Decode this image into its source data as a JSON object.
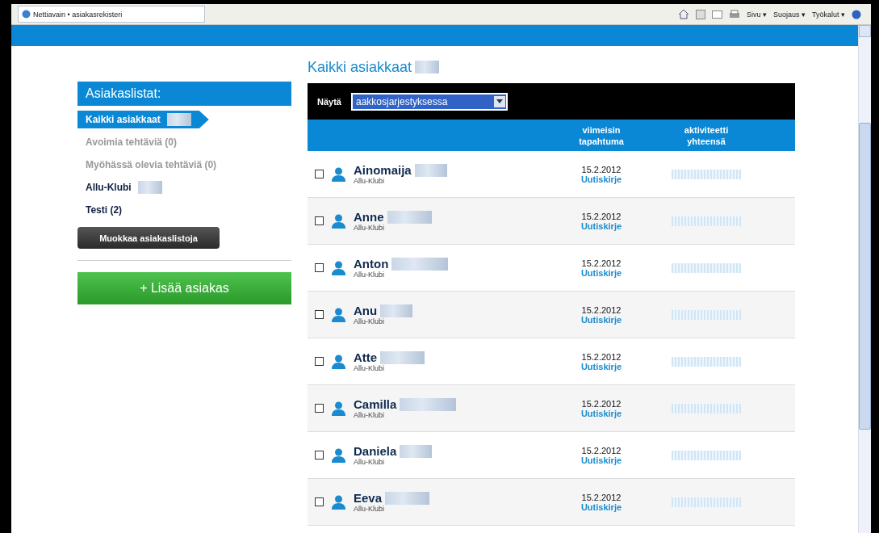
{
  "browser": {
    "tab_title": "Nettiavain • asiakasrekisteri",
    "toolbar": [
      "Sivu ▾",
      "Suojaus ▾",
      "Työkalut ▾"
    ]
  },
  "sidebar": {
    "title": "Asiakaslistat:",
    "items": [
      {
        "label": "Kaikki asiakkaat",
        "selected": true,
        "redacted": true,
        "kind": "list"
      },
      {
        "label": "Avoimia tehtäviä (0)",
        "selected": false,
        "redacted": false,
        "kind": "task"
      },
      {
        "label": "Myöhässä olevia tehtäviä (0)",
        "selected": false,
        "redacted": false,
        "kind": "task"
      },
      {
        "label": "Allu-Klubi",
        "selected": false,
        "redacted": true,
        "kind": "list"
      },
      {
        "label": "Testi (2)",
        "selected": false,
        "redacted": false,
        "kind": "list"
      }
    ],
    "edit_button": "Muokkaa asiakaslistoja",
    "add_button": "+ Lisää asiakas"
  },
  "main": {
    "title": "Kaikki asiakkaat",
    "filter": {
      "label": "Näytä",
      "value": "aakkosjarjestyksessa"
    },
    "columns": [
      "viimeisin tapahtuma",
      "aktiviteetti yhteensä"
    ],
    "rows": [
      {
        "name": "Ainomaija",
        "group": "Allu-Klubi",
        "date": "15.2.2012",
        "event": "Uutiskirje",
        "checked": false
      },
      {
        "name": "Anne",
        "group": "Allu-Klubi",
        "date": "15.2.2012",
        "event": "Uutiskirje",
        "checked": false
      },
      {
        "name": "Anton",
        "group": "Allu-Klubi",
        "date": "15.2.2012",
        "event": "Uutiskirje",
        "checked": false
      },
      {
        "name": "Anu",
        "group": "Allu-Klubi",
        "date": "15.2.2012",
        "event": "Uutiskirje",
        "checked": false
      },
      {
        "name": "Atte",
        "group": "Allu-Klubi",
        "date": "15.2.2012",
        "event": "Uutiskirje",
        "checked": false
      },
      {
        "name": "Camilla",
        "group": "Allu-Klubi",
        "date": "15.2.2012",
        "event": "Uutiskirje",
        "checked": false
      },
      {
        "name": "Daniela",
        "group": "Allu-Klubi",
        "date": "15.2.2012",
        "event": "Uutiskirje",
        "checked": false
      },
      {
        "name": "Eeva",
        "group": "Allu-Klubi",
        "date": "15.2.2012",
        "event": "Uutiskirje",
        "checked": false
      }
    ]
  }
}
